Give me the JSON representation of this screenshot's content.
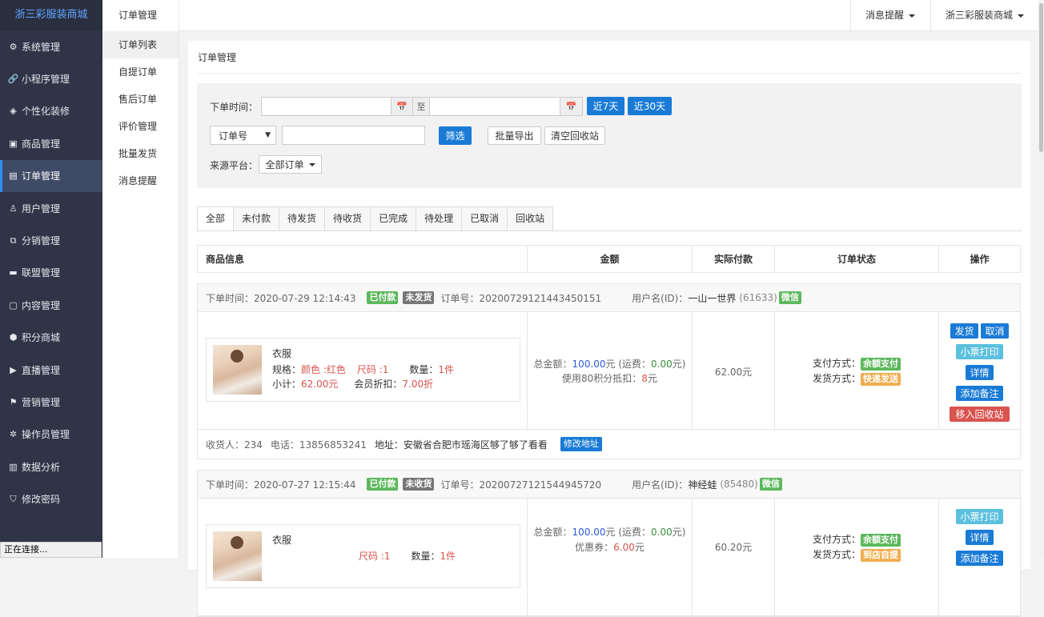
{
  "brand": "浙三彩服装商城",
  "sidebar": {
    "items": [
      {
        "label": "系统管理",
        "icon": "⚙"
      },
      {
        "label": "小程序管理",
        "icon": "🔗"
      },
      {
        "label": "个性化装修",
        "icon": "◈"
      },
      {
        "label": "商品管理",
        "icon": "▣"
      },
      {
        "label": "订单管理",
        "icon": "▤"
      },
      {
        "label": "用户管理",
        "icon": "♙"
      },
      {
        "label": "分销管理",
        "icon": "⧉"
      },
      {
        "label": "联盟管理",
        "icon": "▬"
      },
      {
        "label": "内容管理",
        "icon": "▢"
      },
      {
        "label": "积分商城",
        "icon": "⬢"
      },
      {
        "label": "直播管理",
        "icon": "▶"
      },
      {
        "label": "营销管理",
        "icon": "⚑"
      },
      {
        "label": "操作员管理",
        "icon": "✲"
      },
      {
        "label": "数据分析",
        "icon": "▥"
      },
      {
        "label": "修改密码",
        "icon": "⛉"
      }
    ]
  },
  "subnav": {
    "title": "订单管理",
    "items": [
      "订单列表",
      "自提订单",
      "售后订单",
      "评价管理",
      "批量发货",
      "消息提醒"
    ]
  },
  "topbar": {
    "notice": "消息提醒",
    "store": "浙三彩服装商城"
  },
  "panel": {
    "title": "订单管理",
    "filter": {
      "time_label": "下单时间：",
      "to": "至",
      "calendar_icon": "📅",
      "btn_7": "近7天",
      "btn_30": "近30天",
      "select_value": "订单号",
      "btn_filter": "筛选",
      "btn_export": "批量导出",
      "btn_clear": "清空回收站",
      "platform_label": "来源平台：",
      "platform_value": "全部订单"
    },
    "tabs": [
      "全部",
      "未付款",
      "待发货",
      "待收货",
      "已完成",
      "待处理",
      "已取消",
      "回收站"
    ],
    "columns": [
      "商品信息",
      "金额",
      "实际付款",
      "订单状态",
      "操作"
    ]
  },
  "orders": [
    {
      "time": "下单时间：2020-07-29 12:14:43",
      "pay_badge": "已付款",
      "ship_badge": "未发货",
      "order_no": "订单号：20200729121443450151",
      "user_label": "用户名(ID)：",
      "user_name": "一山一世界",
      "user_id": "(61633)",
      "platform": "微信",
      "goods_name": "衣服",
      "spec_label": "规格：",
      "spec_color": "颜色 :红色",
      "spec_size": "尺码 :1",
      "qty_label": "数量：",
      "qty": "1件",
      "subtotal_label": "小计：",
      "subtotal": "62.00元",
      "discount_label": "会员折扣：",
      "discount": "7.00折",
      "total_label": "总金额：",
      "total": "100.00",
      "total_unit": "元 (运费：",
      "freight": "0.00",
      "freight_unit": "元)",
      "line2_label": "使用80积分抵扣：",
      "line2_value": "8",
      "line2_unit": "元",
      "paid": "62.00元",
      "pay_method_label": "支付方式：",
      "pay_method": "余额支付",
      "ship_method_label": "发货方式：",
      "ship_method": "快递发送",
      "ops": [
        "发货",
        "取消",
        "小票打印",
        "详情",
        "添加备注",
        "移入回收站"
      ],
      "receiver": "收货人：234",
      "phone": "电话：13856853241",
      "address": "地址：安徽省合肥市瑶海区够了够了看看",
      "btn_address": "修改地址"
    },
    {
      "time": "下单时间：2020-07-27 12:15:44",
      "pay_badge": "已付款",
      "ship_badge": "未收货",
      "order_no": "订单号：20200727121544945720",
      "user_label": "用户名(ID)：",
      "user_name": "神经蛙",
      "user_id": "(85480)",
      "platform": "微信",
      "goods_name": "衣服",
      "spec_size": "尺码 :1",
      "qty_label": "数量：",
      "qty": "1件",
      "total_label": "总金额：",
      "total": "100.00",
      "total_unit": "元 (运费：",
      "freight": "0.00",
      "freight_unit": "元)",
      "line2_label": "优惠券：",
      "line2_value": "6.00",
      "line2_unit": "元",
      "paid": "60.20元",
      "pay_method_label": "支付方式：",
      "pay_method": "余额支付",
      "ship_method_label": "发货方式：",
      "ship_method": "到店自提",
      "ops": [
        "小票打印",
        "详情",
        "添加备注"
      ]
    }
  ],
  "status_bar": "正在连接..."
}
